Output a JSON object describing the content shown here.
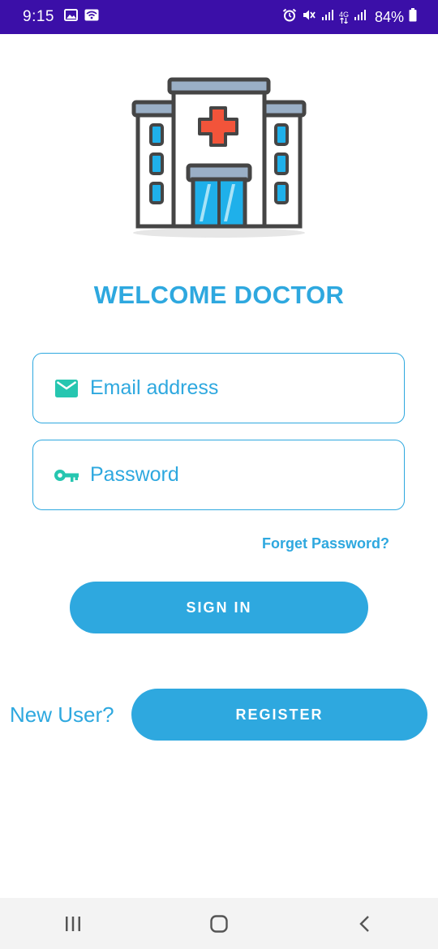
{
  "status_bar": {
    "time": "9:15",
    "battery": "84%",
    "network": "4G"
  },
  "title": "WELCOME DOCTOR",
  "form": {
    "email_placeholder": "Email address",
    "password_placeholder": "Password",
    "forget_password": "Forget Password?",
    "sign_in_label": "SIGN IN"
  },
  "register": {
    "prompt": "New User?",
    "button_label": "REGISTER"
  },
  "icons": {
    "email": "mail-icon",
    "password": "key-icon",
    "logo": "hospital-icon"
  },
  "colors": {
    "accent": "#2ea8df",
    "status_bar": "#3b0fa8",
    "icon_teal": "#26c6b0"
  }
}
